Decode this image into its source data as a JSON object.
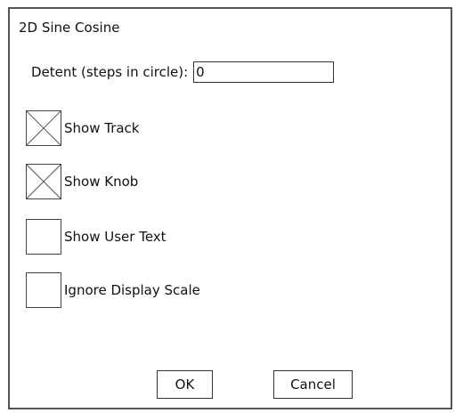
{
  "dialog": {
    "title": "2D Sine Cosine",
    "detent": {
      "label": "Detent (steps in circle):",
      "value": "0"
    },
    "checkboxes": [
      {
        "label": "Show Track",
        "checked": true
      },
      {
        "label": "Show Knob",
        "checked": true
      },
      {
        "label": "Show User Text",
        "checked": false
      },
      {
        "label": "Ignore Display Scale",
        "checked": false
      }
    ],
    "buttons": {
      "ok": "OK",
      "cancel": "Cancel"
    }
  }
}
